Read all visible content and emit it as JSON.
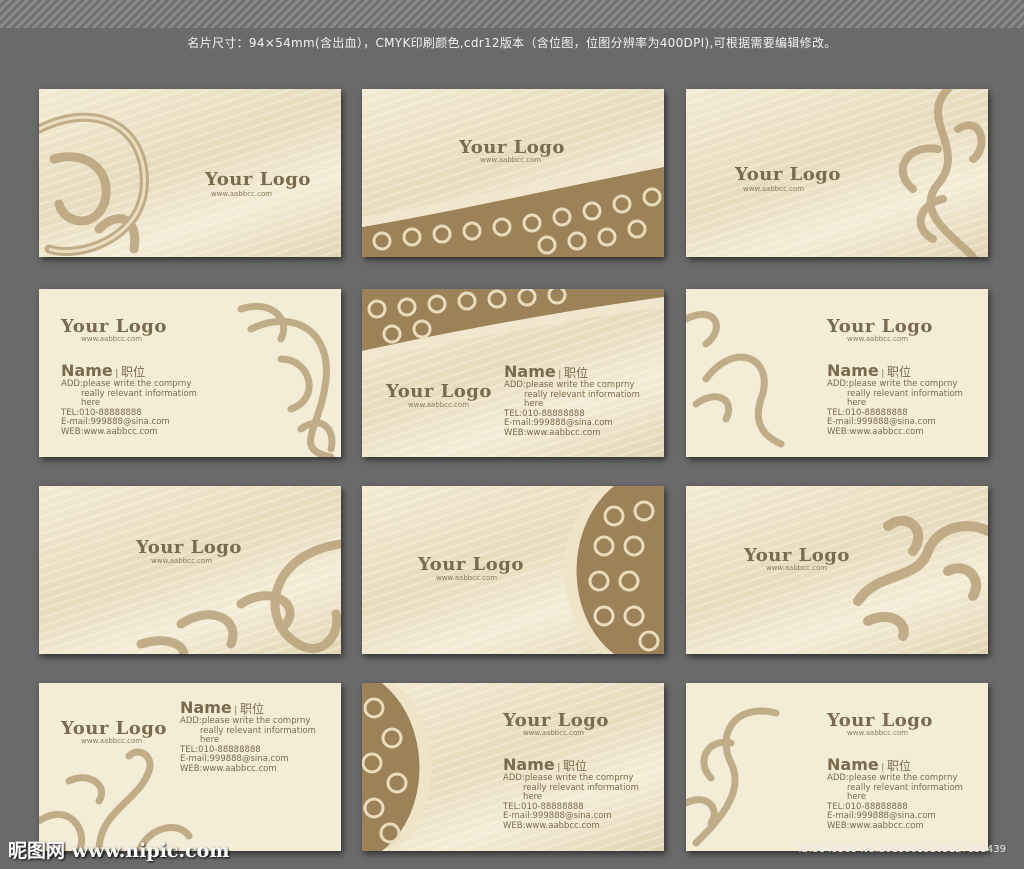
{
  "header": {
    "text": "名片尺寸：94×54mm(含出血），CMYK印刷颜色,cdr12版本（含位图，位图分辨率为400DPI),可根据需要编辑修改。"
  },
  "common": {
    "logo": "Your Logo",
    "url": "www.aabbcc.com",
    "name": "Name",
    "title": "职位",
    "addr1": "ADD:please write the comprny",
    "addr2": "really relevant informatiom",
    "addr3": "here",
    "tel": "TEL:010-88888888",
    "email": "E-mail:999888@sina.com",
    "web": "WEB:www.aabbcc.com"
  },
  "watermark": {
    "site": "昵图网 www.nipic.com",
    "id": "ID:5849568 NO:20180613105127895439"
  },
  "colors": {
    "card_text": "#7a6a4f",
    "card_bg": "#f3ecd6",
    "ornament": "#b8a27a"
  }
}
